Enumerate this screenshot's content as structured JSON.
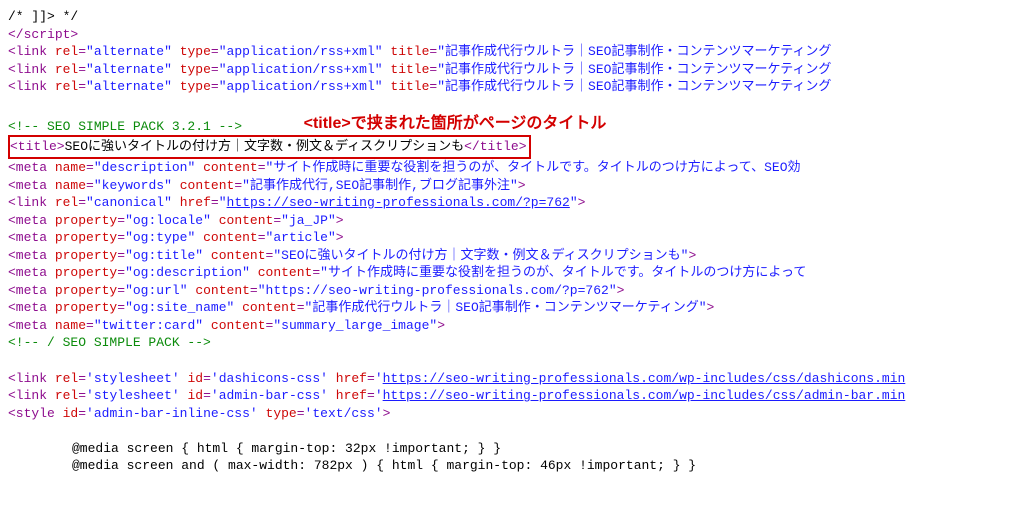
{
  "lines": {
    "l1": "/* ]]> */",
    "l2_open": "</",
    "l2_tag": "script",
    "l2_close": ">",
    "link1_rel": "alternate",
    "link1_type": "application/rss+xml",
    "link1_title": "記事作成代行ウルトラ｜SEO記事制作・コンテンツマーケティング",
    "link2_rel": "alternate",
    "link2_type": "application/rss+xml",
    "link2_title": "記事作成代行ウルトラ｜SEO記事制作・コンテンツマーケティング",
    "link3_rel": "alternate",
    "link3_type": "application/rss+xml",
    "link3_title": "記事作成代行ウルトラ｜SEO記事制作・コンテンツマーケティング",
    "annot_text": "<title>で挟まれた箇所がページのタイトル",
    "cmt_open": "<!-- SEO SIMPLE PACK 3.2.1 -->",
    "title_text": "SEOに強いタイトルの付け方｜文字数・例文＆ディスクリプションも",
    "meta_desc_name": "description",
    "meta_desc_content": "サイト作成時に重要な役割を担うのが、タイトルです。タイトルのつけ方によって、SEO効",
    "meta_kw_name": "keywords",
    "meta_kw_content": "記事作成代行,SEO記事制作,ブログ記事外注",
    "link_canon_rel": "canonical",
    "link_canon_href": "https://seo-writing-professionals.com/?p=762",
    "og_locale_p": "og:locale",
    "og_locale_c": "ja_JP",
    "og_type_p": "og:type",
    "og_type_c": "article",
    "og_title_p": "og:title",
    "og_title_c": "SEOに強いタイトルの付け方｜文字数・例文＆ディスクリプションも",
    "og_desc_p": "og:description",
    "og_desc_c": "サイト作成時に重要な役割を担うのが、タイトルです。タイトルのつけ方によって",
    "og_url_p": "og:url",
    "og_url_c": "https://seo-writing-professionals.com/?p=762",
    "og_site_p": "og:site_name",
    "og_site_c": "記事作成代行ウルトラ｜SEO記事制作・コンテンツマーケティング",
    "tw_card_n": "twitter:card",
    "tw_card_c": "summary_large_image",
    "cmt_close": "<!-- / SEO SIMPLE PACK -->",
    "ss1_rel": "stylesheet",
    "ss1_id": "dashicons-css",
    "ss1_href": "https://seo-writing-professionals.com/wp-includes/css/dashicons.min",
    "ss2_rel": "stylesheet",
    "ss2_id": "admin-bar-css",
    "ss2_href": "https://seo-writing-professionals.com/wp-includes/css/admin-bar.min",
    "style_id": "admin-bar-inline-css",
    "style_type": "text/css",
    "css1": "@media screen { html { margin-top: 32px !important; } }",
    "css2": "@media screen and ( max-width: 782px ) { html { margin-top: 46px !important; } }"
  }
}
